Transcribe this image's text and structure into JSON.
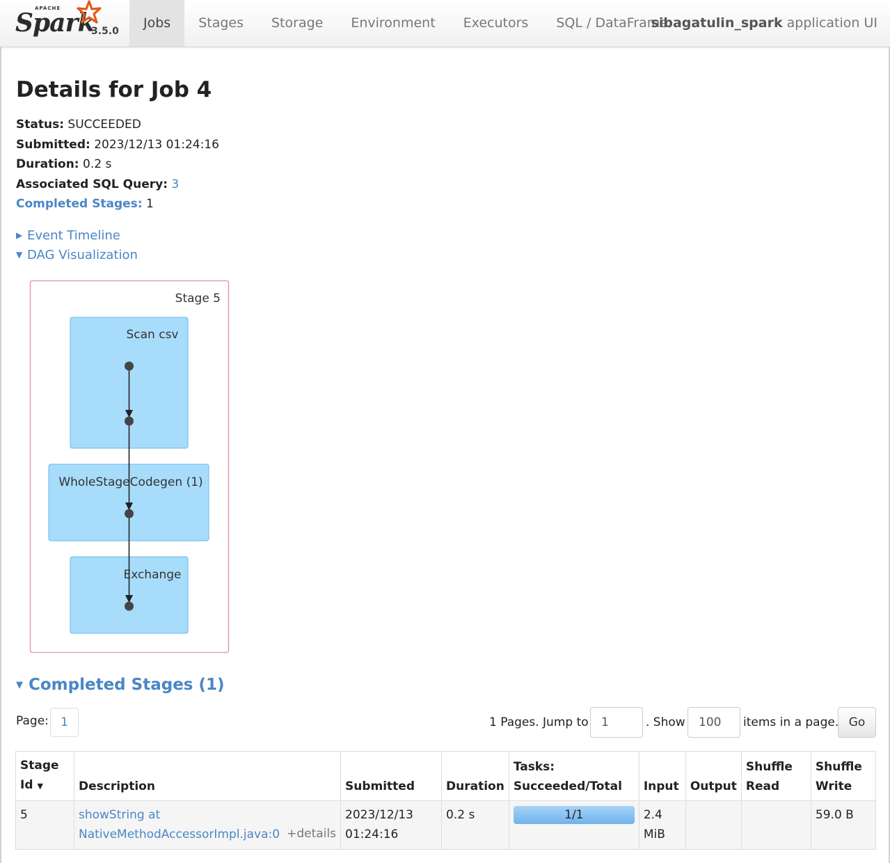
{
  "brand": {
    "apache": "APACHE",
    "name": "Spark",
    "version": "3.5.0"
  },
  "nav": {
    "tabs": [
      {
        "label": "Jobs",
        "active": true
      },
      {
        "label": "Stages",
        "active": false
      },
      {
        "label": "Storage",
        "active": false
      },
      {
        "label": "Environment",
        "active": false
      },
      {
        "label": "Executors",
        "active": false
      },
      {
        "label": "SQL / DataFrame",
        "active": false
      }
    ],
    "app_name": "sibagatulin_spark",
    "app_suffix": " application UI"
  },
  "page_title": "Details for Job 4",
  "summary": {
    "status_label": "Status:",
    "status_value": " SUCCEEDED",
    "submitted_label": "Submitted:",
    "submitted_value": " 2023/12/13 01:24:16",
    "duration_label": "Duration:",
    "duration_value": " 0.2 s",
    "sql_label": "Associated SQL Query:",
    "sql_value": "3",
    "stages_label": "Completed Stages:",
    "stages_value": " 1"
  },
  "expanders": {
    "event_timeline": "Event Timeline",
    "dag": "DAG Visualization"
  },
  "dag": {
    "stage_label": "Stage 5",
    "nodes": [
      "Scan csv",
      "WholeStageCodegen (1)",
      "Exchange"
    ]
  },
  "completed_section": "Completed Stages (1)",
  "paging": {
    "page_label": "Page:",
    "page_current": "1",
    "pages_text": "1 Pages. Jump to",
    "jump_value": "1",
    "show_text": ". Show",
    "show_value": "100",
    "items_text": "items in a page.",
    "go_label": "Go"
  },
  "table": {
    "headers": {
      "stage_id_1": "Stage",
      "stage_id_2": "Id",
      "sort_arrow": "▼",
      "description": "Description",
      "submitted": "Submitted",
      "duration": "Duration",
      "tasks_1": "Tasks:",
      "tasks_2": "Succeeded/Total",
      "input": "Input",
      "output": "Output",
      "shuffle_read_1": "Shuffle",
      "shuffle_read_2": "Read",
      "shuffle_write_1": "Shuffle",
      "shuffle_write_2": "Write"
    },
    "rows": [
      {
        "stage_id": "5",
        "desc_1": "showString at",
        "desc_2": "NativeMethodAccessorImpl.java:0",
        "details": "+details",
        "submitted_1": "2023/12/13",
        "submitted_2": "01:24:16",
        "duration": "0.2 s",
        "tasks": "1/1",
        "tasks_fraction": 1.0,
        "input_1": "2.4",
        "input_2": "MiB",
        "output": "",
        "shuffle_read": "",
        "shuffle_write": "59.0 B"
      }
    ]
  },
  "colors": {
    "link": "#4a86c5",
    "dag_node_fill": "#a8dcfb",
    "stage_border": "#e88ea0"
  }
}
